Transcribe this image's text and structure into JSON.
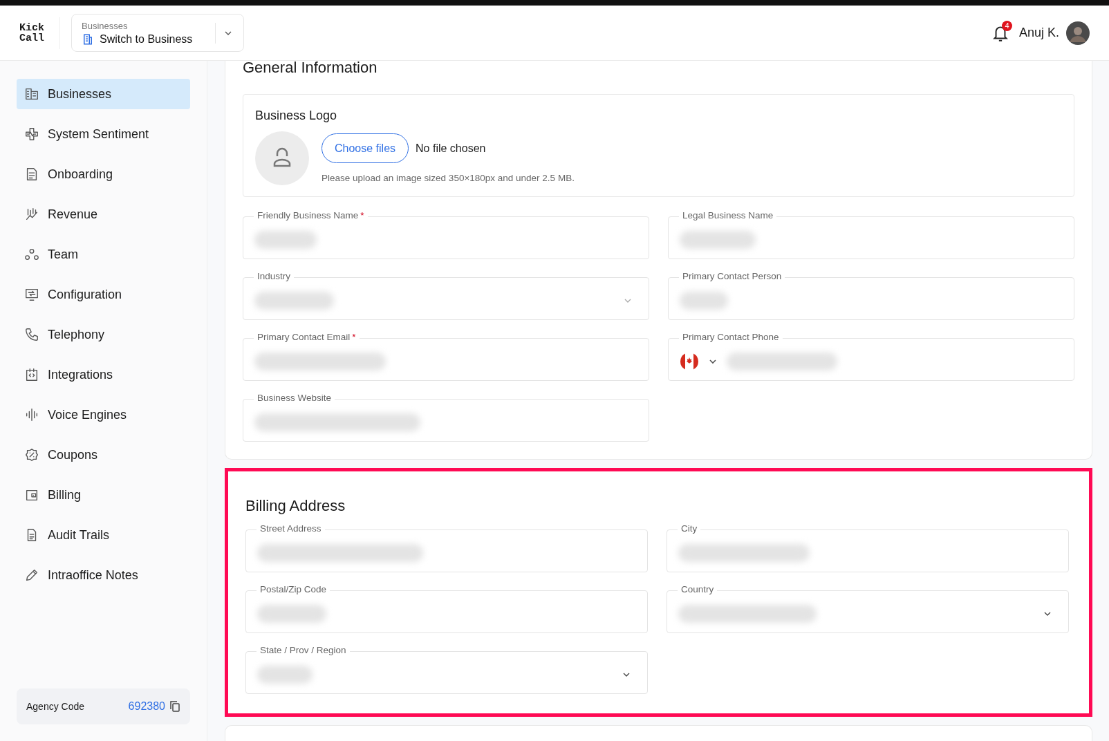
{
  "header": {
    "logo": [
      "Kick",
      "Call"
    ],
    "switcher": {
      "label": "Businesses",
      "value": "Switch to Business"
    },
    "notifications": {
      "count": "4"
    },
    "user": {
      "name": "Anuj K."
    }
  },
  "sidebar": {
    "items": [
      {
        "label": "Businesses",
        "selected": true
      },
      {
        "label": "System Sentiment",
        "selected": false
      },
      {
        "label": "Onboarding",
        "selected": false
      },
      {
        "label": "Revenue",
        "selected": false
      },
      {
        "label": "Team",
        "selected": false
      },
      {
        "label": "Configuration",
        "selected": false
      },
      {
        "label": "Telephony",
        "selected": false
      },
      {
        "label": "Integrations",
        "selected": false
      },
      {
        "label": "Voice Engines",
        "selected": false
      },
      {
        "label": "Coupons",
        "selected": false
      },
      {
        "label": "Billing",
        "selected": false
      },
      {
        "label": "Audit Trails",
        "selected": false
      },
      {
        "label": "Intraoffice Notes",
        "selected": false
      }
    ],
    "agency_code": {
      "label": "Agency Code",
      "value": "692380"
    }
  },
  "general_information": {
    "title": "General Information",
    "business_logo": {
      "title": "Business Logo",
      "button": "Choose files",
      "file_status": "No file chosen",
      "hint": "Please upload an image sized 350×180px and under 2.5 MB."
    },
    "fields": [
      {
        "label": "Friendly Business Name",
        "marker": "*",
        "kind": "text"
      },
      {
        "label": "Legal Business Name",
        "kind": "text"
      },
      {
        "label": "Industry",
        "kind": "select"
      },
      {
        "label": "Primary Contact Person",
        "kind": "text"
      },
      {
        "label": "Primary Contact Email",
        "marker": "*",
        "kind": "text"
      },
      {
        "label": "Primary Contact Phone",
        "kind": "phone"
      },
      {
        "label": "Business Website",
        "kind": "text"
      }
    ]
  },
  "billing_address": {
    "title": "Billing Address",
    "highlighted": true,
    "fields": [
      {
        "label": "Street Address",
        "kind": "text"
      },
      {
        "label": "City",
        "kind": "text"
      },
      {
        "label": "Postal/Zip Code",
        "kind": "text"
      },
      {
        "label": "Country",
        "kind": "select"
      },
      {
        "label": "State / Prov / Region",
        "kind": "select"
      }
    ]
  }
}
